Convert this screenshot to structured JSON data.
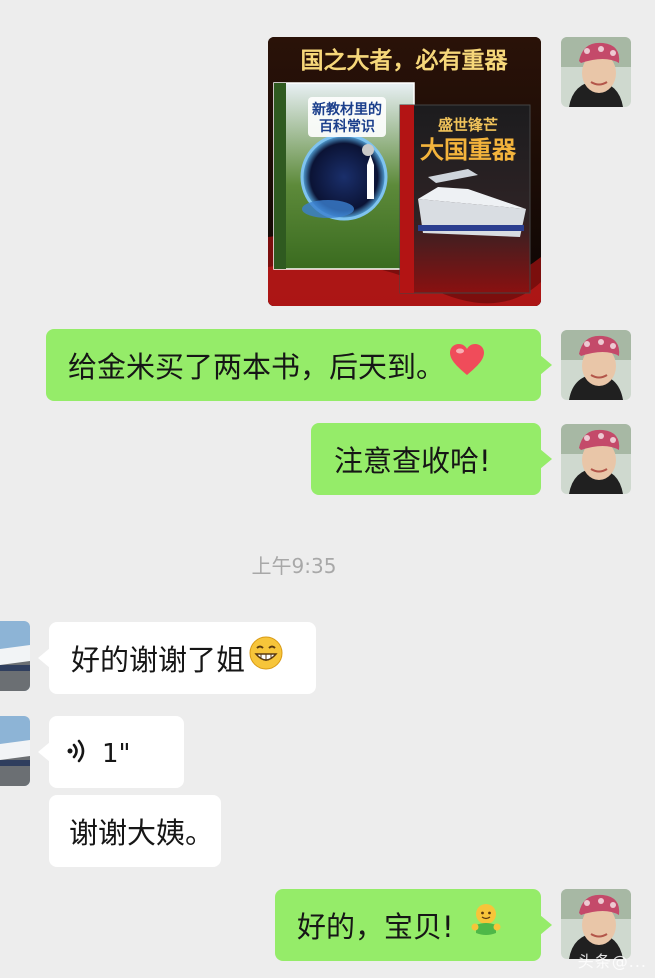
{
  "messages": {
    "image": {
      "banner": "国之大者，必有重器",
      "book1_title_line1": "新教材里的",
      "book1_title_line2": "百科常识",
      "book2_title_line1": "盛世锋芒",
      "book2_title_line2": "大国重器"
    },
    "m1": "给金米买了两本书，后天到。",
    "m2": "注意查收哈!",
    "time": "上午9:35",
    "m3": "好的谢谢了姐",
    "m4_duration": "1\"",
    "m5": "谢谢大姨。",
    "m6": "好的，宝贝!"
  },
  "icons": {
    "heart": "heart-emoji",
    "grin": "grin-emoji",
    "hug": "hug-emoji",
    "voice": "voice-icon"
  },
  "colors": {
    "background": "#ededed",
    "outgoing_bubble": "#95ec69",
    "incoming_bubble": "#ffffff",
    "timestamp": "#a8a8a8"
  },
  "watermark": "头条@..."
}
